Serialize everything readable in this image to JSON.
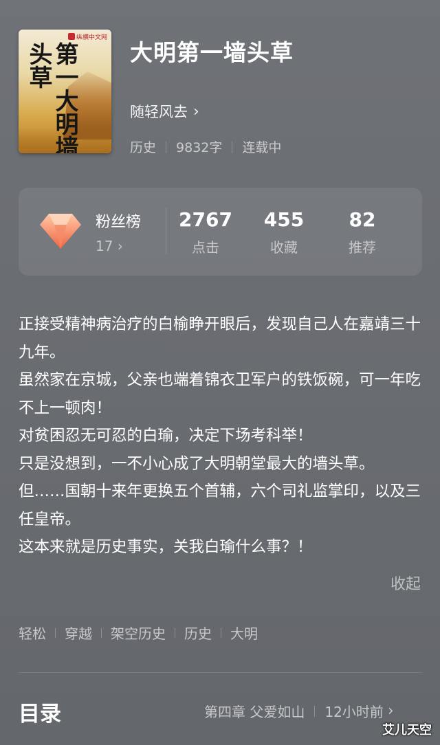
{
  "book": {
    "cover_title": "第一大明墙头草",
    "cover_publisher": "纵横中文网",
    "title": "大明第一墙头草",
    "author": "随轻风去",
    "genre": "历史",
    "word_count": "9832字",
    "status": "连载中"
  },
  "stats": {
    "fans_label": "粉丝榜",
    "fans_rank": "17",
    "clicks_value": "2767",
    "clicks_label": "点击",
    "favorites_value": "455",
    "favorites_label": "收藏",
    "recommends_value": "82",
    "recommends_label": "推荐"
  },
  "description": {
    "lines": [
      "正接受精神病治疗的白榆睁开眼后，发现自己人在嘉靖三十九年。",
      "虽然家在京城，父亲也端着锦衣卫军户的铁饭碗，可一年吃不上一顿肉！",
      "对贫困忍无可忍的白瑜，决定下场考科举！",
      "只是没想到，一不小心成了大明朝堂最大的墙头草。",
      "但……国朝十来年更换五个首辅，六个司礼监掌印，以及三任皇帝。",
      "这本来就是历史事实，关我白瑜什么事？！"
    ],
    "collapse_label": "收起"
  },
  "tags": [
    "轻松",
    "穿越",
    "架空历史",
    "历史",
    "大明"
  ],
  "toc": {
    "title": "目录",
    "latest_chapter": "第四章 父爱如山",
    "updated": "12小时前"
  },
  "watermark": "艾儿天空",
  "colors": {
    "background": "#6c6f74",
    "gem": "#f29a7c"
  },
  "icons": {
    "chevron": "chevron-right-icon",
    "gem": "diamond-icon"
  }
}
